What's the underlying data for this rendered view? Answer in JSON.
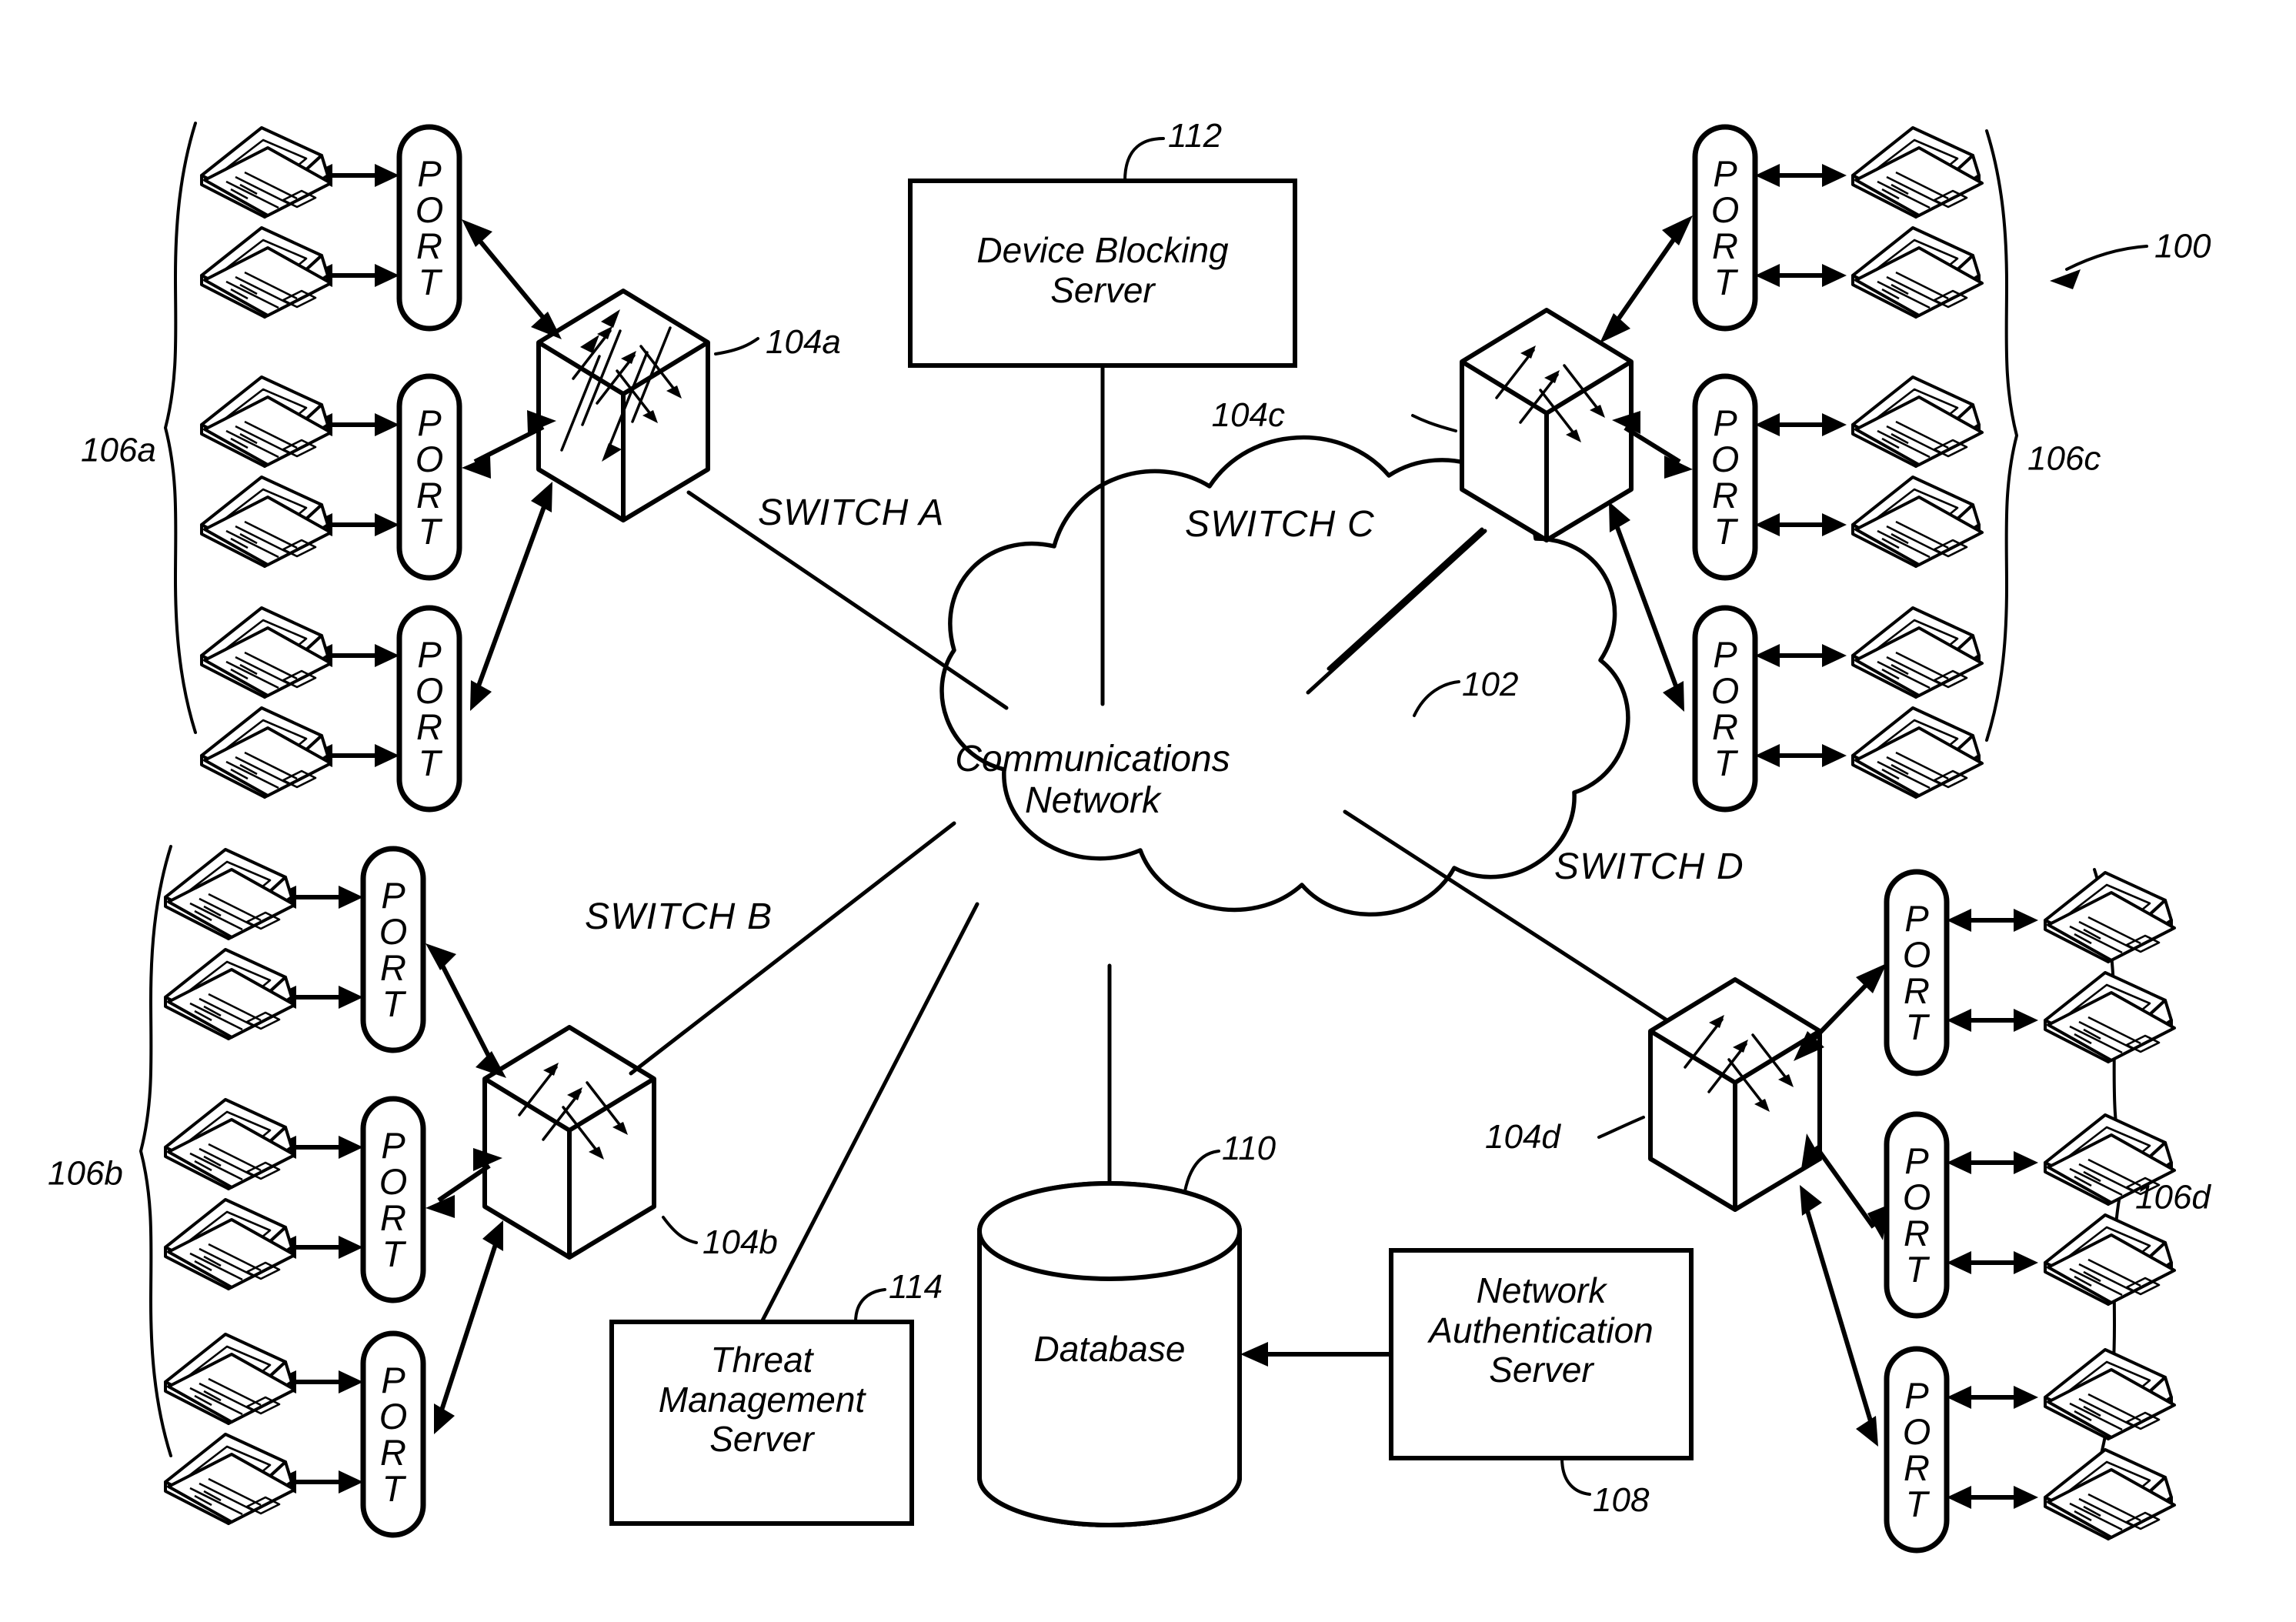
{
  "figure": {
    "type": "patent-network-diagram",
    "system_reference": "100",
    "background": "#ffffff",
    "ink": "#000000"
  },
  "cloud": {
    "label_line1": "Communications",
    "label_line2": "Network",
    "reference": "102"
  },
  "servers": [
    {
      "id": "device-blocking-server",
      "line1": "Device Blocking",
      "line2": "Server",
      "reference": "112"
    },
    {
      "id": "threat-management-server",
      "line1": "Threat",
      "line2": "Management",
      "line3": "Server",
      "reference": "114"
    },
    {
      "id": "network-authentication-server",
      "line1": "Network",
      "line2": "Authentication",
      "line3": "Server",
      "reference": "108"
    }
  ],
  "database": {
    "label": "Database",
    "reference": "110"
  },
  "switches": [
    {
      "id": "switch-a",
      "label": "SWITCH A",
      "reference": "104a",
      "group": "106a",
      "port_count": 3
    },
    {
      "id": "switch-b",
      "label": "SWITCH B",
      "reference": "104b",
      "group": "106b",
      "port_count": 3
    },
    {
      "id": "switch-c",
      "label": "SWITCH C",
      "reference": "104c",
      "group": "106c",
      "port_count": 3
    },
    {
      "id": "switch-d",
      "label": "SWITCH D",
      "reference": "104d",
      "group": "106d",
      "port_count": 3
    }
  ],
  "port": {
    "letters": [
      "P",
      "O",
      "R",
      "T"
    ],
    "text": "PORT"
  },
  "groups": [
    {
      "id": "106a",
      "label": "106a",
      "side": "left",
      "ports": 3,
      "devices_per_port": 2
    },
    {
      "id": "106b",
      "label": "106b",
      "side": "left",
      "ports": 3,
      "devices_per_port": 2
    },
    {
      "id": "106c",
      "label": "106c",
      "side": "right",
      "ports": 3,
      "devices_per_port": 2
    },
    {
      "id": "106d",
      "label": "106d",
      "side": "right",
      "ports": 3,
      "devices_per_port": 2
    }
  ],
  "device_icon": "laptop-icon",
  "reference_numerals": [
    "100",
    "102",
    "104a",
    "104b",
    "104c",
    "104d",
    "106a",
    "106b",
    "106c",
    "106d",
    "108",
    "110",
    "112",
    "114"
  ]
}
